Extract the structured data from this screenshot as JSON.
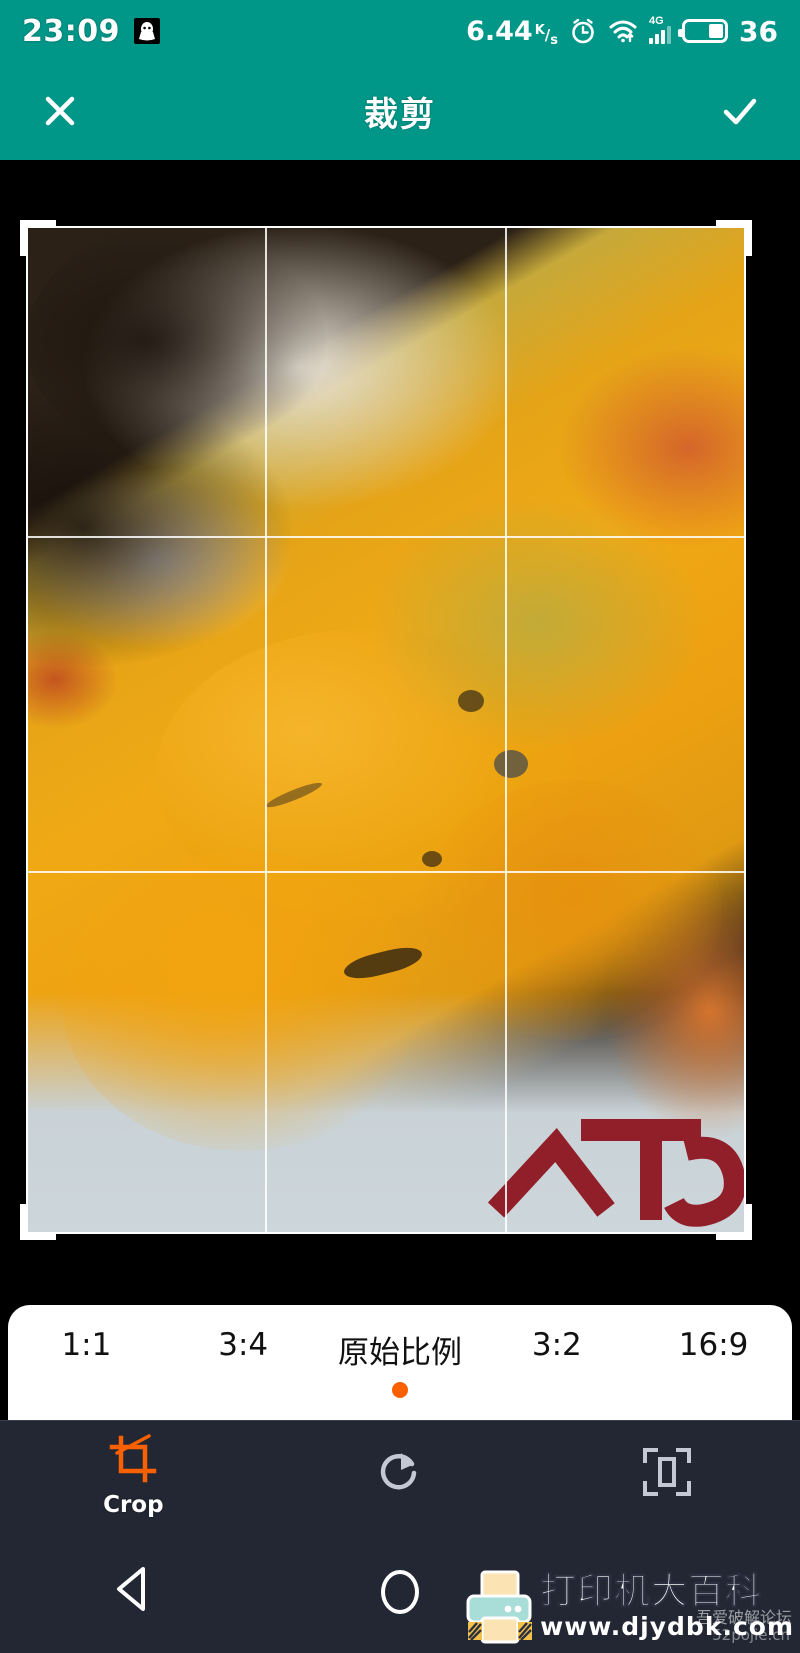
{
  "status_bar": {
    "time": "23:09",
    "notification_icon": "qq-penguin-icon",
    "network_speed_value": "6.44",
    "network_speed_unit_top": "K",
    "network_speed_unit_bottom": "s",
    "alarm_icon": "alarm-clock-icon",
    "wifi_icon": "wifi-icon",
    "mobile_network_label": "4G",
    "signal_icon": "signal-bars-icon",
    "battery_icon": "battery-icon",
    "battery_level": "36",
    "background_color": "#009688"
  },
  "app_bar": {
    "close_label": "close-icon",
    "title": "裁剪",
    "confirm_label": "check-icon",
    "background_color": "#009688"
  },
  "editor": {
    "crop_frame": {
      "grid_rows": 3,
      "grid_columns": 3,
      "handle_count": 4
    },
    "photo_description": "papaya-vegetables-photo"
  },
  "ratio_bar": {
    "options": [
      {
        "label": "1:1",
        "selected": false
      },
      {
        "label": "3:4",
        "selected": false
      },
      {
        "label": "原始比例",
        "selected": true
      },
      {
        "label": "3:2",
        "selected": false
      },
      {
        "label": "16:9",
        "selected": false
      }
    ],
    "selected_indicator_color": "#F96000",
    "background_color": "#ffffff"
  },
  "toolbar": {
    "background_color": "#222733",
    "active_color": "#F96000",
    "inactive_color": "#c3c9d4",
    "tools": [
      {
        "icon": "crop-icon",
        "label": "Crop",
        "active": true
      },
      {
        "icon": "rotate-right-icon",
        "label": "",
        "active": false
      },
      {
        "icon": "straighten-frame-icon",
        "label": "",
        "active": false
      }
    ]
  },
  "nav_bar": {
    "background_color": "#222733",
    "buttons": [
      {
        "icon": "back-triangle-icon",
        "name": "back"
      },
      {
        "icon": "home-circle-icon",
        "name": "home"
      }
    ]
  },
  "watermark": {
    "brand": "打印机大百科",
    "url": "www.djydbk.com",
    "overlay_text": "吾爱破解论坛",
    "overlay_text_2": "52pojie.cn",
    "icon": "printer-icon"
  }
}
